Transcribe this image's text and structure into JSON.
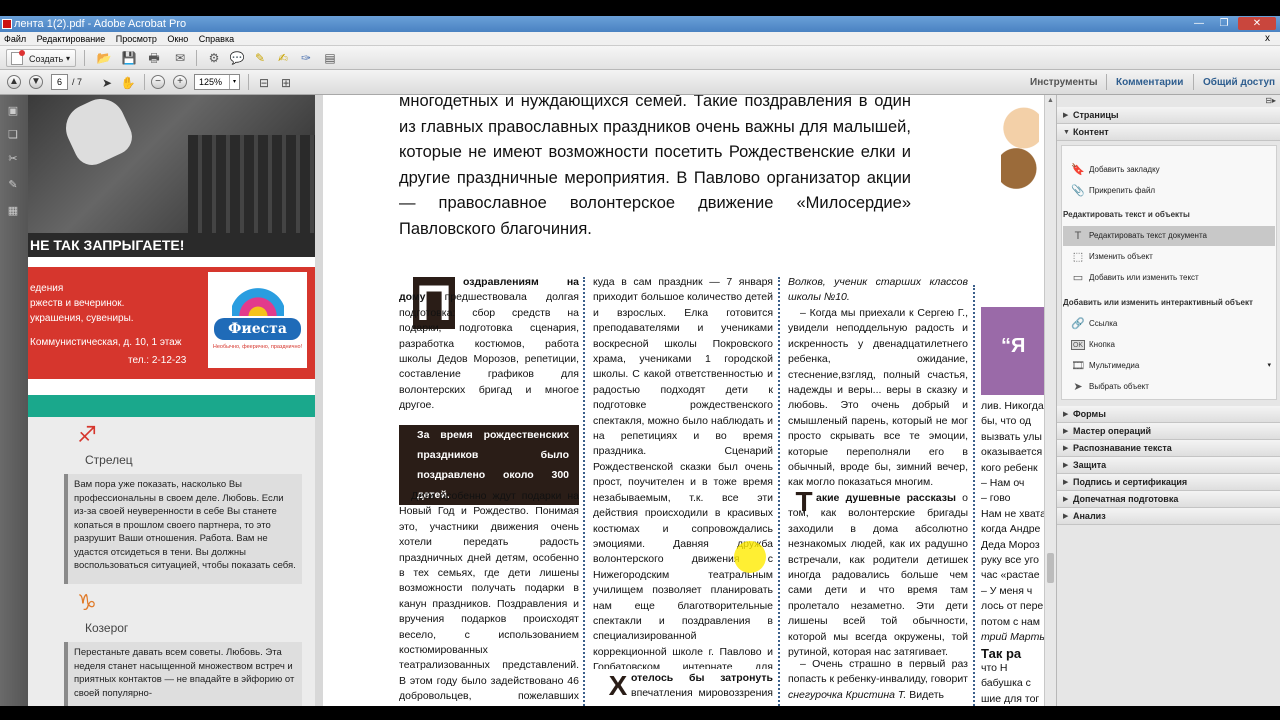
{
  "window": {
    "title": "лента 1(2).pdf - Adobe Acrobat Pro",
    "min_label": "—",
    "max_label": "❐",
    "close_label": "✕"
  },
  "menu": {
    "items": [
      "Файл",
      "Редактирование",
      "Просмотр",
      "Окно",
      "Справка"
    ],
    "close": "x"
  },
  "toolbar": {
    "create_label": "Создать",
    "create_arrow": "▾",
    "page_current": "6",
    "page_total": "/ 7",
    "zoom_value": "125%",
    "zoom_arrow": "▾",
    "zoom_out": "−",
    "zoom_in": "+"
  },
  "right_links": {
    "tools": "Инструменты",
    "comments": "Комментарии",
    "share": "Общий доступ"
  },
  "panel": {
    "pages": "Страницы",
    "content": "Контент",
    "add_bookmark": "Добавить закладку",
    "attach_file": "Прикрепить файл",
    "edit_text_objects": "Редактировать текст и объекты",
    "edit_doc_text": "Редактировать текст документа",
    "edit_object": "Изменить объект",
    "add_edit_text": "Добавить или изменить текст",
    "add_edit_interactive": "Добавить или изменить интерактивный объект",
    "link": "Ссылка",
    "button": "Кнопка",
    "multimedia": "Мультимедиа",
    "select_object": "Выбрать объект",
    "forms": "Формы",
    "action_wizard": "Мастер операций",
    "text_recognition": "Распознавание текста",
    "protection": "Защита",
    "sign_certify": "Подпись и сертификация",
    "print_production": "Допечатная подготовка",
    "analysis": "Анализ"
  },
  "document": {
    "ad_headline": "НЕ ТАК ЗАПРЫГАЕТЕ!",
    "ad_lines": [
      "едения",
      "ржеств и вечеринок.",
      "украшения, сувениры."
    ],
    "ad_address": "Коммунистическая, д. 10, 1 этаж",
    "ad_phone": "тел.: 2-12-23",
    "logo_name": "Фиеста",
    "logo_slogan": "Необычно, феерично, празднично!",
    "sign1": "Стрелец",
    "sign1_text": "Вам пора уже показать, насколько Вы профессиональны в своем деле. Любовь. Если из-за своей неуверенности в себе Вы станете копаться в прошлом своего партнера, то это разрушит Ваши отношения. Работа. Вам не удастся отсидеться в тени. Вы должны воспользоваться ситуацией, чтобы показать себя.",
    "sign2": "Козерог",
    "sign2_text": "Перестаньте давать всем советы. Любовь. Эта неделя станет насыщенной множеством встреч и приятных контактов — не впадайте в эйфорию от своей популярно-",
    "lead_text": "многодетных и нуждающихся семей. Такие поздравления в один из главных православных праздников очень важны для малышей, которые не имеют возможности посетить Рождественские елки и другие праздничные мероприятия. В Павлово организатор акции — православное волонтерское движение «Милосердие» Павловского благочиния.",
    "col1_dropcap": "П",
    "col1_bold": "оздравлениям на дому",
    "col1_p1": "предшествовала долгая подготовка: сбор средств на подарки, подготовка сценария, разработка костюмов, работа школы Дедов Морозов, репетиции, составление графиков для волонтерских бригад и многое другое.",
    "col1_highlight": "За время рождественских праздников было поздравлено около 300 детей.",
    "col1_p2": "Дети особенно ждут подарки на Новый Год и Рождество. Понимая это, участники движения очень хотели передать радость праздничных дней детям, особенно в тех семьях, где дети лишены возможности получать подарки в канун праздников. Поздравления и вручения подарков происходят весело, с использованием костюмированных театрализованных представлений. В этом году было задействовано 46 добровольцев, пожелавших поучаствовать в добрых делах. Не-",
    "col2_p1": "куда в сам праздник — 7 января приходит большое количество детей и взрослых. Елка готовится преподавателями и учениками воскресной школы Покровского храма, учениками 1 городской школы. С какой ответственностью и радостью подходят дети к подготовке рождественского спектакля, можно было наблюдать и на репетициях и во время праздника. Сценарий Рождественской сказки был очень прост, поучителен и в тоже время незабываемым, т.к. все эти действия происходили в красивых костюмах и сопровождались эмоциями. Давняя дружба волонтерского движения с Нижегородским театральным училищем позволяет планировать нам еще благотворительные спектакли и поздравления в специализированной коррекционной школе г. Павлово и Горбатовском интернате для глухонемых детей, где студенты — театралов всегда ждут и любят.",
    "col2_dropcap": "Х",
    "col2_bold": "отелось бы затронуть",
    "col2_tail": "впечатления мировоззрения у",
    "col3_intro": "Волков, ученик старших классов школы №10.",
    "col3_p1": "– Когда мы приехали к Сергею Г., увидели неподдельную радость и искренность у двенадцатилетнего ребенка, ожидание, стеснение,взгляд, полный счастья, надежды и веры... веры в сказку и любовь. Это очень добрый и смышленый парень, который не мог просто скрывать все те эмоции, которые переполняли его в обычный, вроде бы, зимний вечер, как могло показаться многим.",
    "col3_dropcap": "Т",
    "col3_bold": "акие душевные рассказы",
    "col3_p2": "о том, как волонтерские бригады заходили в дома абсолютно незнакомых людей, как их радушно встречали, как родители детишек иногда радовались больше чем сами дети и что время там пролетало незаметно. Эти дети лишены всей той обычности, которой мы всегда окружены, той рутиной, которая нас затягивает.",
    "col3_p3": "– Очень страшно в первый раз попасть к ребенку-инвалиду, говорит",
    "col3_italic": "снегурочка Кристина Т.",
    "col3_p3b": "Видеть",
    "col4_quote": "“Я",
    "col4_lines": [
      "лив. Никогда",
      "бы, что од",
      "вызвать улы",
      "оказывается",
      "кого ребенк",
      "– Нам оч",
      "– гово",
      "Нам не хвата",
      "когда Андре",
      "Деда Мороз",
      "руку все уго",
      "час «растае",
      "– У меня ч",
      "лось от пере",
      "потом с нам",
      "трий Марты",
      "Так ра",
      "что Н",
      "бабушка с",
      "шие для тог"
    ]
  }
}
